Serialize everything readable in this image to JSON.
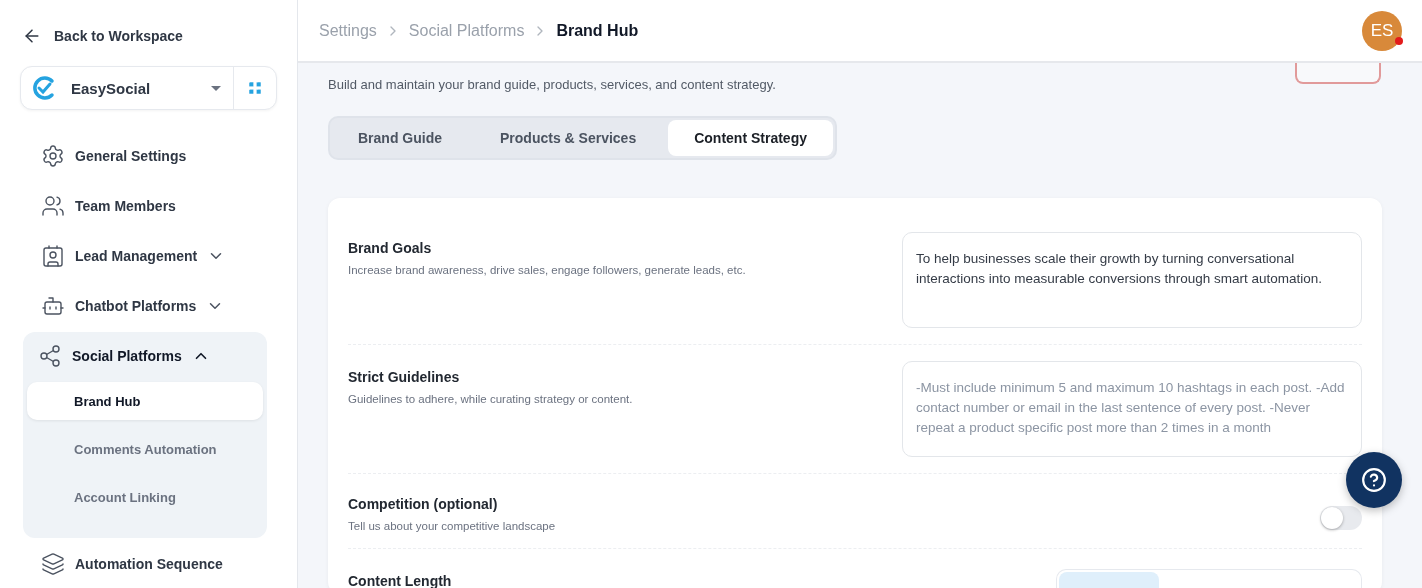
{
  "back_link": "Back to Workspace",
  "workspace": {
    "name": "EasySocial"
  },
  "sidebar": {
    "items": [
      {
        "label": "General Settings",
        "kind": "item"
      },
      {
        "label": "Team Members",
        "kind": "item"
      },
      {
        "label": "Lead Management",
        "kind": "group",
        "expanded": false
      },
      {
        "label": "Chatbot Platforms",
        "kind": "group",
        "expanded": false
      },
      {
        "label": "Social Platforms",
        "kind": "group",
        "expanded": true,
        "children": [
          {
            "label": "Brand Hub",
            "selected": true
          },
          {
            "label": "Comments Automation",
            "selected": false
          },
          {
            "label": "Account Linking",
            "selected": false
          }
        ]
      },
      {
        "label": "Automation Sequence",
        "kind": "item"
      }
    ]
  },
  "breadcrumb": [
    "Settings",
    "Social Platforms",
    "Brand Hub"
  ],
  "avatar": {
    "initials": "ES",
    "notification": true
  },
  "subtitle": "Build and maintain your brand guide, products, services, and content strategy.",
  "tabs": [
    {
      "label": "Brand Guide",
      "selected": false
    },
    {
      "label": "Products & Services",
      "selected": false
    },
    {
      "label": "Content Strategy",
      "selected": true
    }
  ],
  "fields": [
    {
      "kind": "text",
      "label": "Brand Goals",
      "hint": "Increase brand awareness, drive sales, engage followers, generate leads, etc.",
      "value": "To help businesses scale their growth by turning conversational interactions into measurable conversions through smart automation."
    },
    {
      "kind": "text",
      "label": "Strict Guidelines",
      "hint": "Guidelines to adhere, while curating strategy or content.",
      "placeholder": "-Must include minimum 5 and maximum 10 hashtags in each post. -Add contact number or email in the last sentence of every post. -Never repeat a product specific post more than 2 times in a month"
    },
    {
      "kind": "toggle",
      "label": "Competition (optional)",
      "hint": "Tell us about your competitive landscape",
      "on": false
    },
    {
      "kind": "segments",
      "label": "Content Length"
    }
  ]
}
